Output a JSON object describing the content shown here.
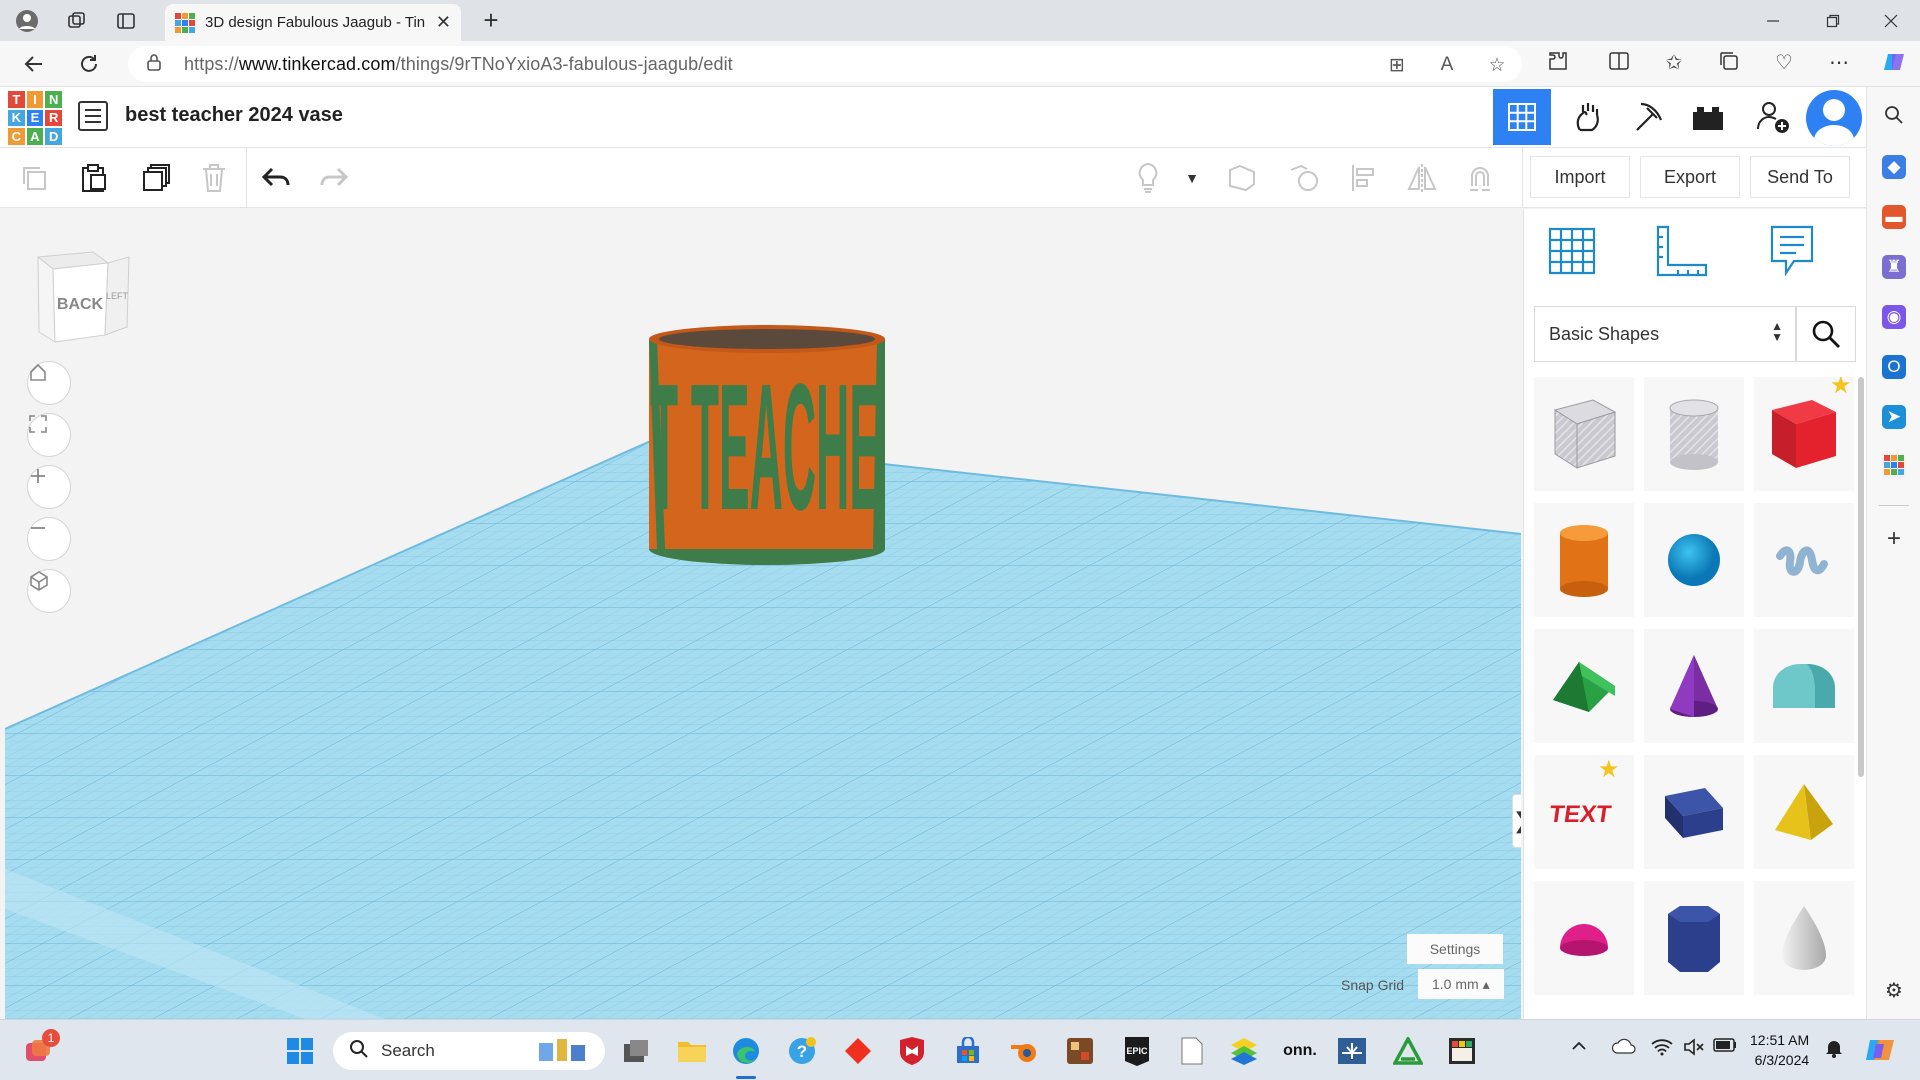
{
  "browser": {
    "tab_title": "3D design Fabulous Jaagub - Tin",
    "tab_close": "✕",
    "new_tab": "+",
    "url_prefix": "https://",
    "url_domain": "www.tinkercad.com",
    "url_path": "/things/9rTNoYxioA3-fabulous-jaagub/edit"
  },
  "tinkercad": {
    "logo_letters": [
      "T",
      "I",
      "N",
      "K",
      "E",
      "R",
      "C",
      "A",
      "D"
    ],
    "logo_colors": [
      "#e2493b",
      "#f09a36",
      "#4cb050",
      "#46a6e0",
      "#2e81f3",
      "#e2493b",
      "#f09a36",
      "#4cb050",
      "#46a6e0"
    ],
    "design_title": "best teacher 2024 vase"
  },
  "toolbar": {
    "import_label": "Import",
    "export_label": "Export",
    "send_to_label": "Send To"
  },
  "viewport": {
    "viewcube_back": "BACK",
    "viewcube_left": "LEFT",
    "object_text": "T TEACHE",
    "settings_label": "Settings",
    "snap_grid_label": "Snap Grid",
    "snap_grid_value": "1.0 mm ▴",
    "collapse_glyph": "❯"
  },
  "panel": {
    "category_label": "Basic Shapes",
    "shapes": [
      "Box Hole",
      "Cylinder Hole",
      "Box",
      "Cylinder",
      "Sphere",
      "Scribble",
      "Roof",
      "Cone",
      "Round Roof",
      "Text",
      "Wedge",
      "Pyramid",
      "Half Sphere",
      "Polygon",
      "Paraboloid"
    ]
  },
  "taskbar": {
    "search_label": "Search",
    "notification_count": "1",
    "onn_label": "onn.",
    "epic_label": "EPIC",
    "time": "12:51 AM",
    "date": "6/3/2024"
  },
  "colors": {
    "accent": "#2e81f3",
    "grid_blue": "#8fd0ec",
    "object_orange": "#d3651d",
    "object_green": "#3e7d49"
  }
}
